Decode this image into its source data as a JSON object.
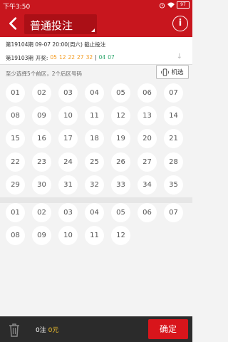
{
  "status": {
    "time": "下午3:50",
    "battery": "97"
  },
  "appbar": {
    "title": "普通投注",
    "info_label": "i"
  },
  "issue": {
    "period": "第19104期",
    "deadline": "09-07 20:00(周六) 截止投注"
  },
  "history": {
    "period": "第19103期",
    "label": "开奖:",
    "front": [
      "05",
      "12",
      "22",
      "27",
      "32"
    ],
    "back": [
      "04",
      "07"
    ]
  },
  "selection": {
    "hint": "至少选择5个前区，2个后区号码",
    "random_label": "机选"
  },
  "front_numbers": [
    "01",
    "02",
    "03",
    "04",
    "05",
    "06",
    "07",
    "08",
    "09",
    "10",
    "11",
    "12",
    "13",
    "14",
    "15",
    "16",
    "17",
    "18",
    "19",
    "20",
    "21",
    "22",
    "23",
    "24",
    "25",
    "26",
    "27",
    "28",
    "29",
    "30",
    "31",
    "32",
    "33",
    "34",
    "35"
  ],
  "back_numbers": [
    "01",
    "02",
    "03",
    "04",
    "05",
    "06",
    "07",
    "08",
    "09",
    "10",
    "11",
    "12"
  ],
  "footer": {
    "count": "0注",
    "amount": "0元",
    "confirm_label": "确定"
  }
}
